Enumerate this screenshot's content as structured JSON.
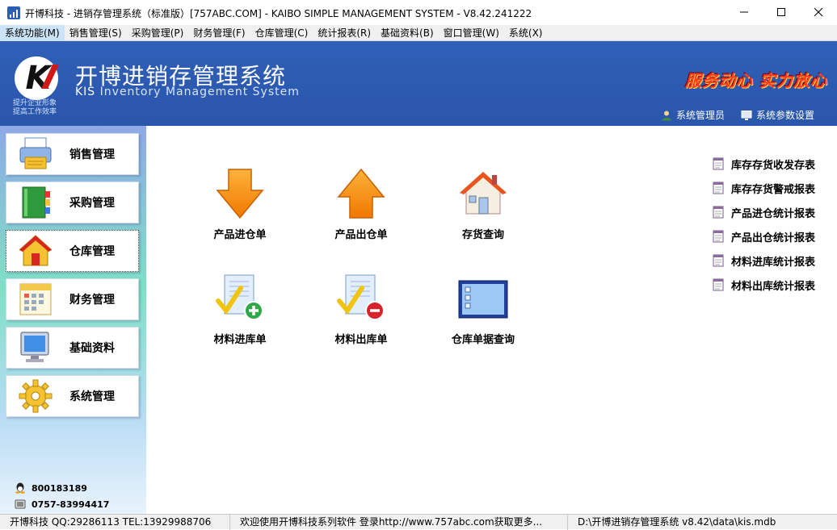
{
  "window": {
    "title": "开博科技 - 进销存管理系统（标准版）[757ABC.COM] - KAIBO SIMPLE MANAGEMENT SYSTEM - V8.42.241222",
    "controls": {
      "minimize": "—",
      "maximize": "☐",
      "close": "✕"
    }
  },
  "menu": [
    {
      "label": "系统功能(M)"
    },
    {
      "label": "销售管理(S)"
    },
    {
      "label": "采购管理(P)"
    },
    {
      "label": "财务管理(F)"
    },
    {
      "label": "仓库管理(C)"
    },
    {
      "label": "统计报表(R)"
    },
    {
      "label": "基础资料(B)"
    },
    {
      "label": "窗口管理(W)"
    },
    {
      "label": "系统(X)"
    }
  ],
  "banner": {
    "logo_letter": "K",
    "slogan_line1": "提升企业形象",
    "slogan_line2": "提高工作效率",
    "app_name": "开博进销存管理系统",
    "app_sub_kis": "KIS",
    "app_sub_rest": " Inventory Management System",
    "motto": "服务动心 实力放心",
    "user_label": "系统管理员",
    "settings_label": "系统参数设置"
  },
  "sidebar": {
    "buttons": [
      {
        "label": "销售管理",
        "icon": "printer-icon"
      },
      {
        "label": "采购管理",
        "icon": "book-icon"
      },
      {
        "label": "仓库管理",
        "icon": "house-icon",
        "selected": true
      },
      {
        "label": "财务管理",
        "icon": "calendar-icon"
      },
      {
        "label": "基础资料",
        "icon": "monitor-icon"
      },
      {
        "label": "系统管理",
        "icon": "gear-icon"
      }
    ],
    "qq": "800183189",
    "phone": "0757-83994417"
  },
  "tiles": [
    {
      "label": "产品进仓单",
      "icon": "arrow-down-icon"
    },
    {
      "label": "产品出仓单",
      "icon": "arrow-up-icon"
    },
    {
      "label": "存货查询",
      "icon": "house-icon"
    },
    {
      "label": "材料进库单",
      "icon": "doc-check-add-icon"
    },
    {
      "label": "材料出库单",
      "icon": "doc-check-remove-icon"
    },
    {
      "label": "仓库单据查询",
      "icon": "list-window-icon"
    }
  ],
  "reports": [
    {
      "label": "库存存货收发存表"
    },
    {
      "label": "库存存货警戒报表"
    },
    {
      "label": "产品进仓统计报表"
    },
    {
      "label": "产品出仓统计报表"
    },
    {
      "label": "材料进库统计报表"
    },
    {
      "label": "材料出库统计报表"
    }
  ],
  "status": {
    "company": "开博科技 QQ:29286113 TEL:13929988706",
    "welcome": "欢迎使用开博科技系列软件    登录http://www.757abc.com获取更多...",
    "db_path": "D:\\开博进销存管理系统 v8.42\\data\\kis.mdb"
  }
}
